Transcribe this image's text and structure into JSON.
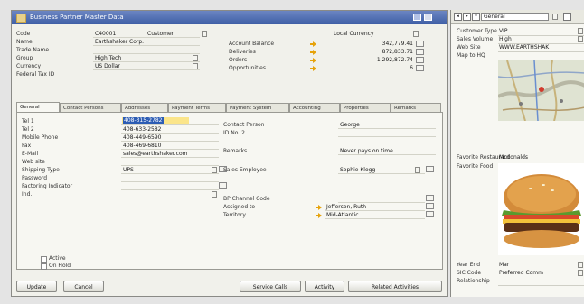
{
  "window": {
    "title": "Business Partner Master Data"
  },
  "header": {
    "code_label": "Code",
    "code_value": "C40001",
    "type_value": "Customer",
    "name_label": "Name",
    "name_value": "Earthshaker Corp.",
    "foreign_name_label": "Trade Name",
    "foreign_name_value": "",
    "group_label": "Group",
    "group_value": "High Tech",
    "currency_label": "Currency",
    "currency_value": "US Dollar",
    "tax_id_label": "Federal Tax ID",
    "tax_id_value": "",
    "local_currency": "Local Currency",
    "account_balance_label": "Account Balance",
    "account_balance_value": "342,779.41",
    "deliveries_label": "Deliveries",
    "deliveries_value": "872,833.71",
    "orders_label": "Orders",
    "orders_value": "1,292,872.74",
    "opportunities_label": "Opportunities",
    "opportunities_value": "6"
  },
  "tabs": [
    "General",
    "Contact Persons",
    "Addresses",
    "Payment Terms",
    "Payment System",
    "Accounting",
    "Properties",
    "Remarks"
  ],
  "general": {
    "tel1_label": "Tel 1",
    "tel1_value": "408-315-2782",
    "tel2_label": "Tel 2",
    "tel2_value": "408-633-2582",
    "mobile_label": "Mobile Phone",
    "mobile_value": "408-449-6590",
    "fax_label": "Fax",
    "fax_value": "408-469-6810",
    "email_label": "E-Mail",
    "email_value": "sales@earthshaker.com",
    "website_label": "Web site",
    "website_value": "",
    "shipping_label": "Shipping Type",
    "shipping_value": "UPS",
    "password_label": "Password",
    "password_value": "",
    "factoring_label": "Factoring Indicator",
    "factoring_value": "",
    "industry_label": "Ind.",
    "industry_value": "",
    "contact_label": "Contact Person",
    "contact_value": "George",
    "id2_label": "ID No. 2",
    "id2_value": "",
    "remarks_label": "Remarks",
    "remarks_value": "Never pays on time",
    "sales_emp_label": "Sales Employee",
    "sales_emp_value": "Sophie Klogg",
    "channel_label": "BP Channel Code",
    "channel_value": "",
    "assigned_label": "Assigned to",
    "assigned_value": "Jefferson, Ruth",
    "territory_label": "Territory",
    "territory_value": "Mid-Atlantic",
    "active_label": "Active",
    "onhold_label": "On Hold"
  },
  "buttons": {
    "update": "Update",
    "cancel": "Cancel",
    "service_calls": "Service Calls",
    "activity": "Activity",
    "related": "Related Activities"
  },
  "side": {
    "combo": "General",
    "customer_type_label": "Customer Type",
    "customer_type_value": "VIP",
    "sales_volume_label": "Sales Volume",
    "sales_volume_value": "High",
    "website_label": "Web Site",
    "website_value": "WWW.EARTHSHAK",
    "map_label": "Map to HQ",
    "restaurant_label": "Favorite Restaurant",
    "restaurant_value": "Mcdonalds",
    "food_label": "Favorite Food",
    "year_end_label": "Year End",
    "year_end_value": "Mar",
    "sic_label": "SIC Code",
    "sic_value": "Preferred Comm",
    "relationship_label": "Relationship",
    "relationship_value": ""
  }
}
